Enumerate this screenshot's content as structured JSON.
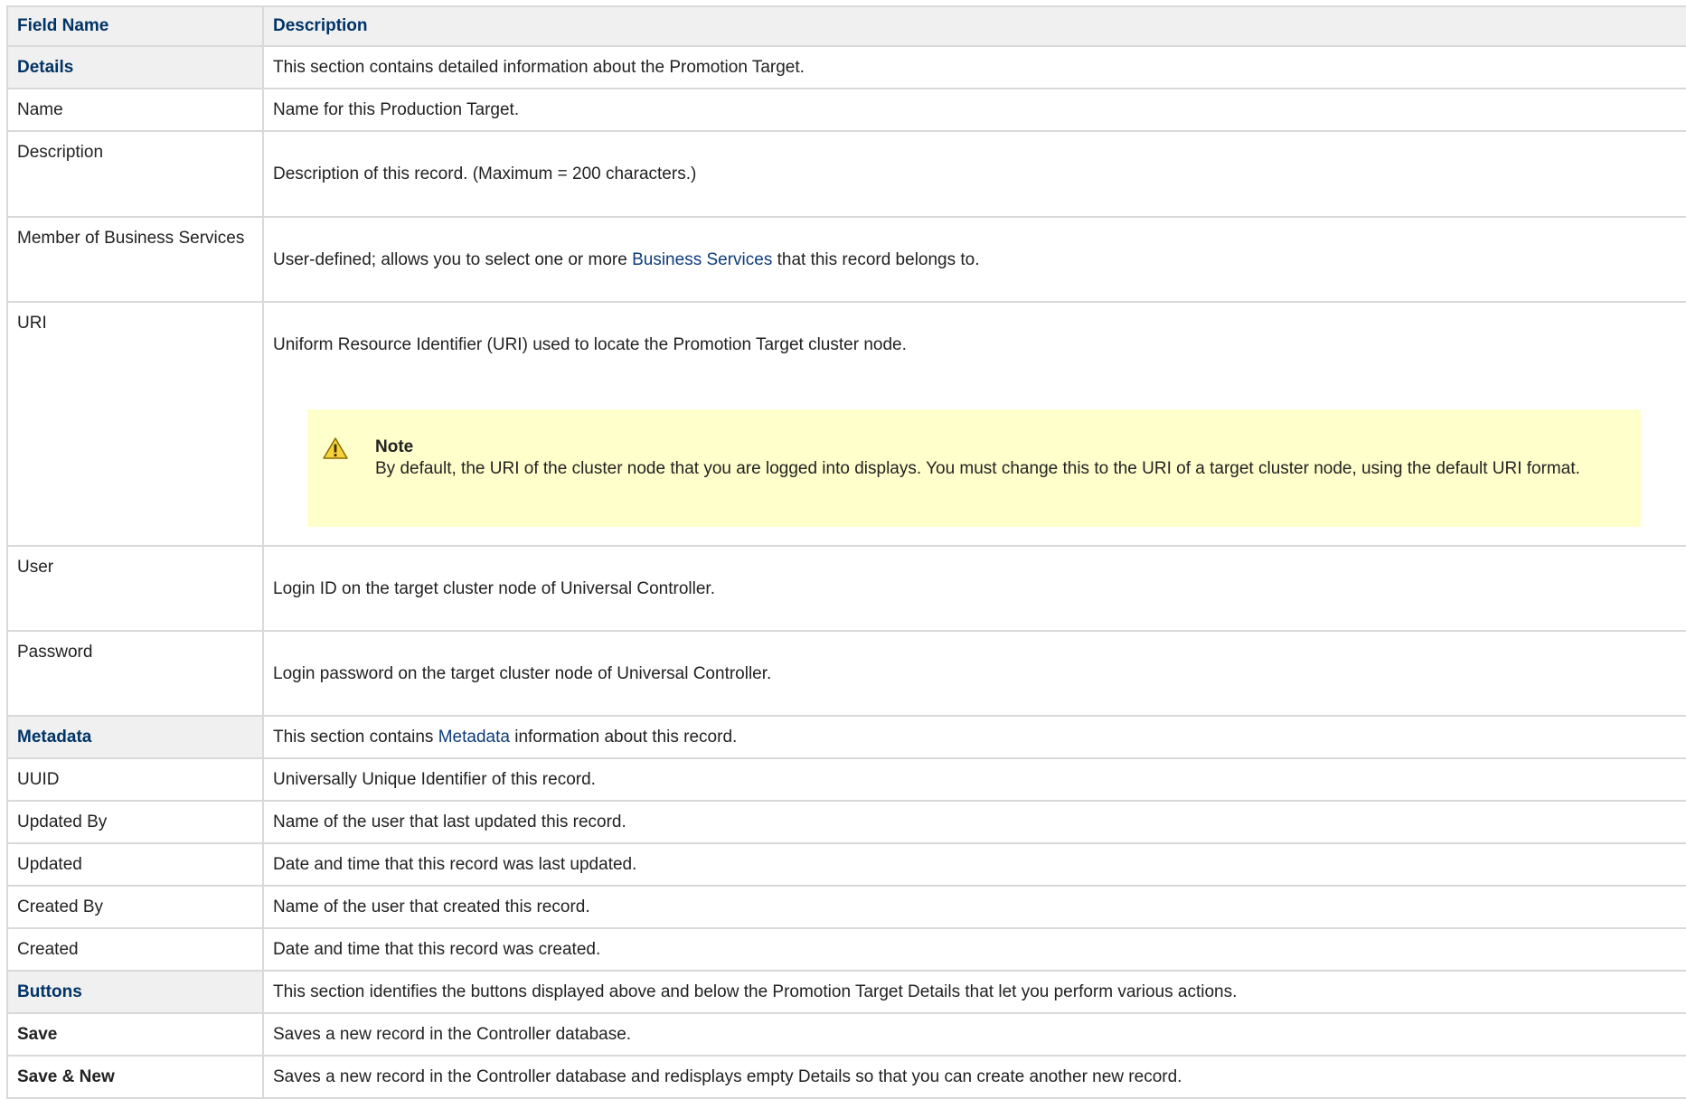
{
  "header": {
    "field_name": "Field Name",
    "description": "Description"
  },
  "rows": [
    {
      "name": "Details",
      "desc": "This section contains detailed information about the Promotion Target."
    },
    {
      "name": "Name",
      "desc": "Name for this Production Target."
    },
    {
      "name": "Description",
      "desc": "Description of this record. (Maximum = 200 characters.)"
    },
    {
      "name": "Member of Business Services",
      "desc_before": "User-defined; allows you to select one or more ",
      "link": "Business Services",
      "desc_after": " that this record belongs to."
    },
    {
      "name": "URI",
      "desc": "Uniform Resource Identifier (URI) used to locate the Promotion Target cluster node.",
      "note_title": "Note",
      "note_text": "By default, the URI of the cluster node that you are logged into displays. You must change this to the URI of a target cluster node, using the default URI format."
    },
    {
      "name": "User",
      "desc": "Login ID on the target cluster node of Universal Controller."
    },
    {
      "name": "Password",
      "desc": "Login password on the target cluster node of Universal Controller."
    },
    {
      "name": "Metadata",
      "desc_before": "This section contains ",
      "link": "Metadata",
      "desc_after": " information about this record."
    },
    {
      "name": "UUID",
      "desc": "Universally Unique Identifier of this record."
    },
    {
      "name": "Updated By",
      "desc": "Name of the user that last updated this record."
    },
    {
      "name": "Updated",
      "desc": "Date and time that this record was last updated."
    },
    {
      "name": "Created By",
      "desc": "Name of the user that created this record."
    },
    {
      "name": "Created",
      "desc": "Date and time that this record was created."
    },
    {
      "name": "Buttons",
      "desc": "This section identifies the buttons displayed above and below the Promotion Target Details that let you perform various actions."
    },
    {
      "name": "Save",
      "desc": "Saves a new record in the Controller database."
    },
    {
      "name": "Save & New",
      "desc": "Saves a new record in the Controller database and redisplays empty Details so that you can create another new record."
    }
  ]
}
